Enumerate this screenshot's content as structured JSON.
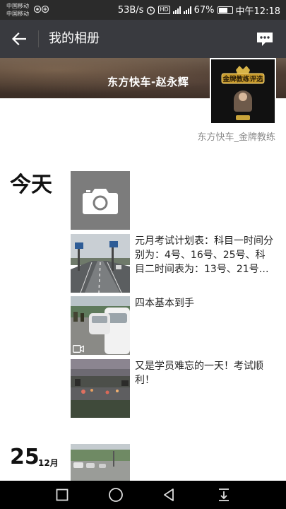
{
  "status_bar": {
    "carrier_1": "中国移动",
    "carrier_2": "中国移动",
    "net_speed": "53B/s",
    "network_1": "4G",
    "network_2": "4G",
    "battery_percent": "67%",
    "battery_level": 0.67,
    "time": "中午12:18",
    "icons": [
      "alarm-icon",
      "hd-icon",
      "signal-icon",
      "battery-icon"
    ]
  },
  "title_bar": {
    "title": "我的相册",
    "back_icon": "arrow-left-icon",
    "message_icon": "message-icon"
  },
  "profile": {
    "name": "东方快车-赵永辉",
    "signature": "东方快车_金牌教练",
    "avatar_badge_text": "金牌教练评选"
  },
  "timeline": {
    "today_label": "今天",
    "camera_icon": "camera-icon",
    "posts": [
      {
        "text": "元月考试计划表：科目一时间分别为：4号、16号、25号、科目二时间表为：13号、21号…"
      },
      {
        "text": "四本基本到手",
        "has_video": true
      },
      {
        "text": "又是学员难忘的一天！考试顺利！"
      }
    ],
    "next_date": {
      "day": "25",
      "month": "12月"
    }
  },
  "nav_bar": {
    "icons": [
      "recent-apps-icon",
      "home-icon",
      "back-triangle-icon",
      "notification-pull-icon"
    ]
  },
  "colors": {
    "title_bar_bg": "#393a3f",
    "status_bar_bg": "#2b2b2b",
    "camera_tile_bg": "#7c7c7c",
    "signature_text": "#8a8a8a"
  }
}
